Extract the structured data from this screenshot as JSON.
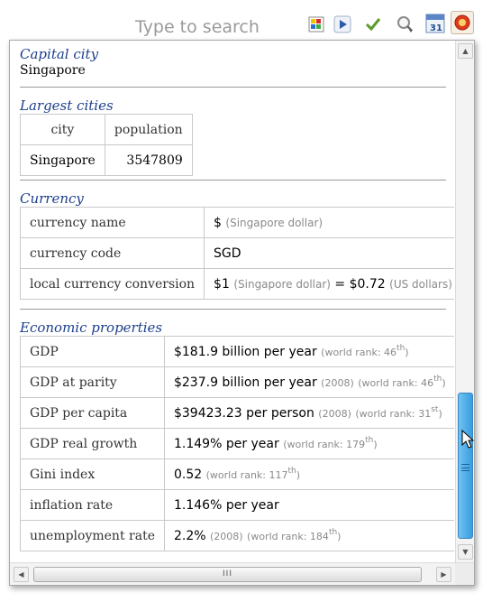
{
  "toolbar": {
    "search_placeholder": "Type to search",
    "calendar_day": "31",
    "icons": [
      "color-blocks-icon",
      "play-icon",
      "checkmark-icon",
      "magnifier-icon",
      "calendar-icon",
      "gear-icon"
    ]
  },
  "capital": {
    "title": "Capital city",
    "value": "Singapore"
  },
  "largest_cities": {
    "title": "Largest cities",
    "headers": [
      "city",
      "population"
    ],
    "rows": [
      {
        "city": "Singapore",
        "population": "3547809"
      }
    ]
  },
  "currency": {
    "title": "Currency",
    "rows": [
      {
        "label": "currency name",
        "value": "$",
        "note": "(Singapore dollar)"
      },
      {
        "label": "currency code",
        "value": "SGD"
      },
      {
        "label": "local currency conversion",
        "v1": "$1",
        "n1": "(Singapore dollar)",
        "eq": "=",
        "v2": "$0.72",
        "n2": "(US dollars)"
      }
    ]
  },
  "economic": {
    "title": "Economic properties",
    "rows": [
      {
        "label": "GDP",
        "value": "$181.9 billion per year",
        "year": "",
        "rank_label": "(world rank: 46",
        "rank_sup": "th",
        "rank_close": ")"
      },
      {
        "label": "GDP at parity",
        "value": "$237.9 billion per year",
        "year": "(2008)",
        "rank_label": "(world rank: 46",
        "rank_sup": "th",
        "rank_close": ")"
      },
      {
        "label": "GDP per capita",
        "value": "$39423.23 per person",
        "year": "(2008)",
        "rank_label": "(world rank: 31",
        "rank_sup": "st",
        "rank_close": ")"
      },
      {
        "label": "GDP real growth",
        "value": "1.149% per year",
        "year": "",
        "rank_label": "(world rank: 179",
        "rank_sup": "th",
        "rank_close": ")"
      },
      {
        "label": "Gini index",
        "value": "0.52",
        "year": "",
        "rank_label": "(world rank: 117",
        "rank_sup": "th",
        "rank_close": ")"
      },
      {
        "label": "inflation rate",
        "value": "1.146% per year",
        "year": "",
        "rank_label": "",
        "rank_sup": "",
        "rank_close": ""
      },
      {
        "label": "unemployment rate",
        "value": "2.2%",
        "year": "(2008)",
        "rank_label": "(world rank: 184",
        "rank_sup": "th",
        "rank_close": ")"
      }
    ]
  },
  "scrollbars": {
    "grip": "III",
    "v_position_fraction": 0.85,
    "h_position_fraction": 0.0
  },
  "colors": {
    "section_title": "#1c3f8c",
    "scroll_thumb": "#3a9de0"
  }
}
